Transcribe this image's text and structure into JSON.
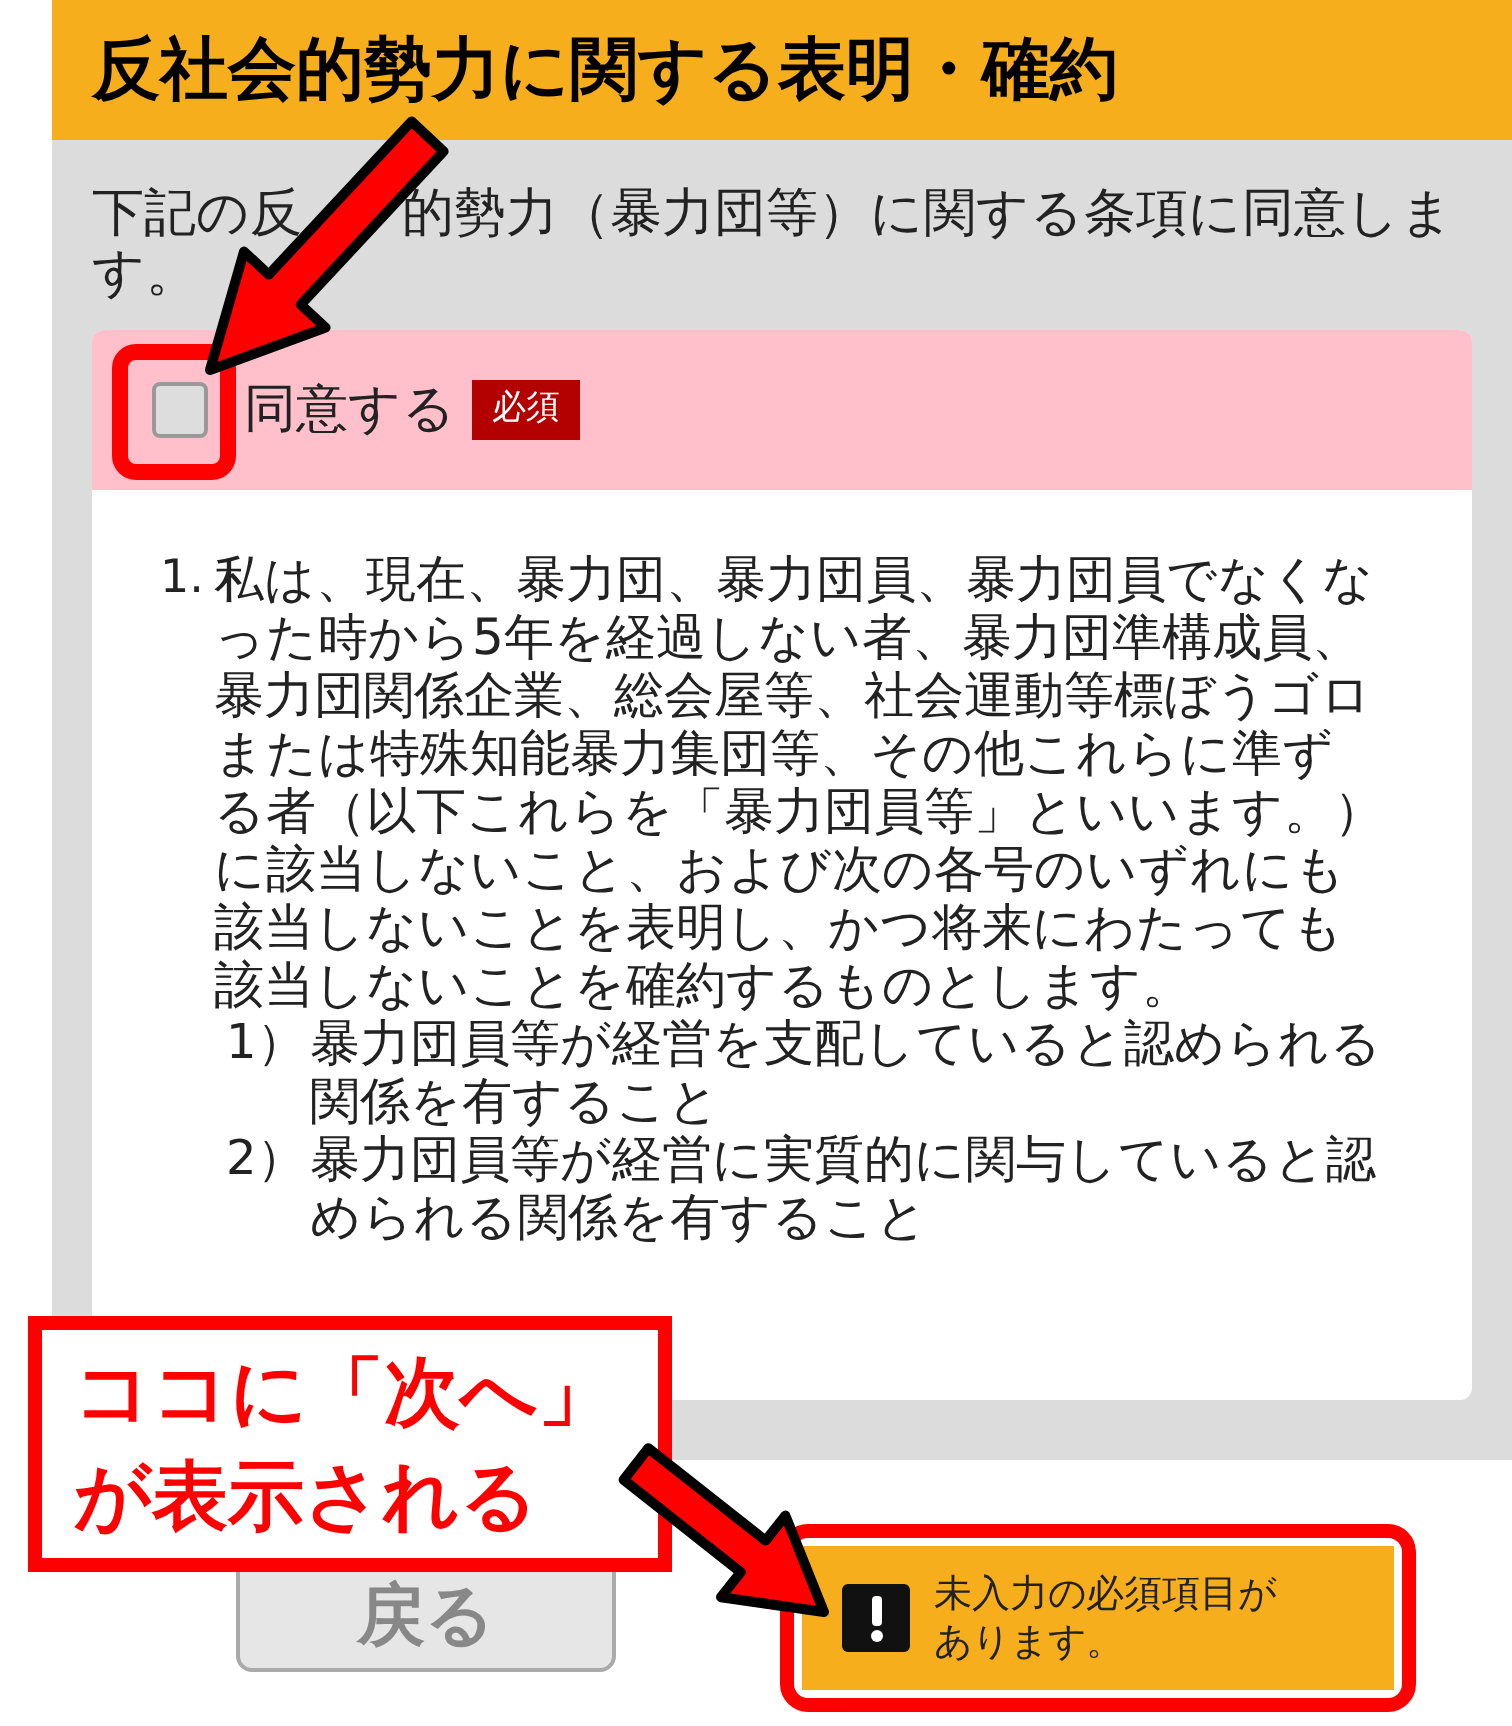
{
  "header": {
    "title": "反社会的勢力に関する表明・確約"
  },
  "description": [
    "下記の反",
    "的勢力（暴力団等）に関する条項に同意しま",
    "す。"
  ],
  "agreement": {
    "label": "同意する",
    "badge": "必須",
    "checked": false
  },
  "terms": [
    {
      "number": "1.",
      "text": "私は、現在、暴力団、暴力団員、暴力団員でなくなった時から5年を経過しない者、暴力団準構成員、暴力団関係企業、総会屋等、社会運動等標ぼうゴロまたは特殊知能暴力集団等、その他これらに準ずる者（以下これらを「暴力団員等」といいます。）に該当しないこと、および次の各号のいずれにも該当しないことを表明し、かつ将来にわたっても該当しないことを確約するものとします。",
      "subitems": [
        {
          "number": "1）",
          "text": "暴力団員等が経営を支配していると認められる関係を有すること"
        },
        {
          "number": "2）",
          "text": "暴力団員等が経営に実質的に関与していると認められる関係を有すること"
        }
      ]
    }
  ],
  "back_button": "戻る",
  "warning": "未入力の必須項目があります。",
  "annotation": {
    "lines": [
      "ココに「次へ」",
      "が表示される"
    ]
  }
}
